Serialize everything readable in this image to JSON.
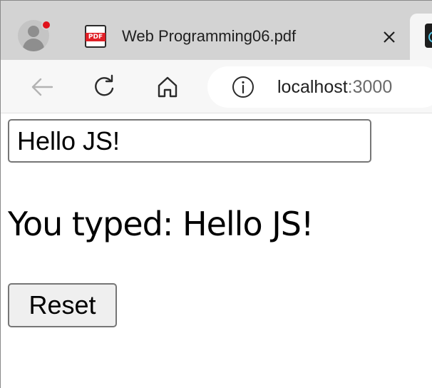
{
  "browser": {
    "tab": {
      "title": "Web Programming06.pdf",
      "favicon": "pdf-icon",
      "favicon_label": "PDF"
    },
    "profile": {
      "icon": "profile-avatar-icon",
      "badge_color": "#e0121b"
    },
    "next_tab": {
      "icon": "react-app-favicon"
    },
    "toolbar": {
      "back_icon": "arrow-left-icon",
      "reload_icon": "reload-icon",
      "home_icon": "home-icon",
      "site_info_icon": "info-icon"
    },
    "address": {
      "host": "localhost",
      "port": ":3000"
    }
  },
  "page": {
    "input": {
      "value": "Hello JS!"
    },
    "typed_prefix": "You typed: ",
    "typed_value": "Hello JS!",
    "reset_label": "Reset"
  }
}
